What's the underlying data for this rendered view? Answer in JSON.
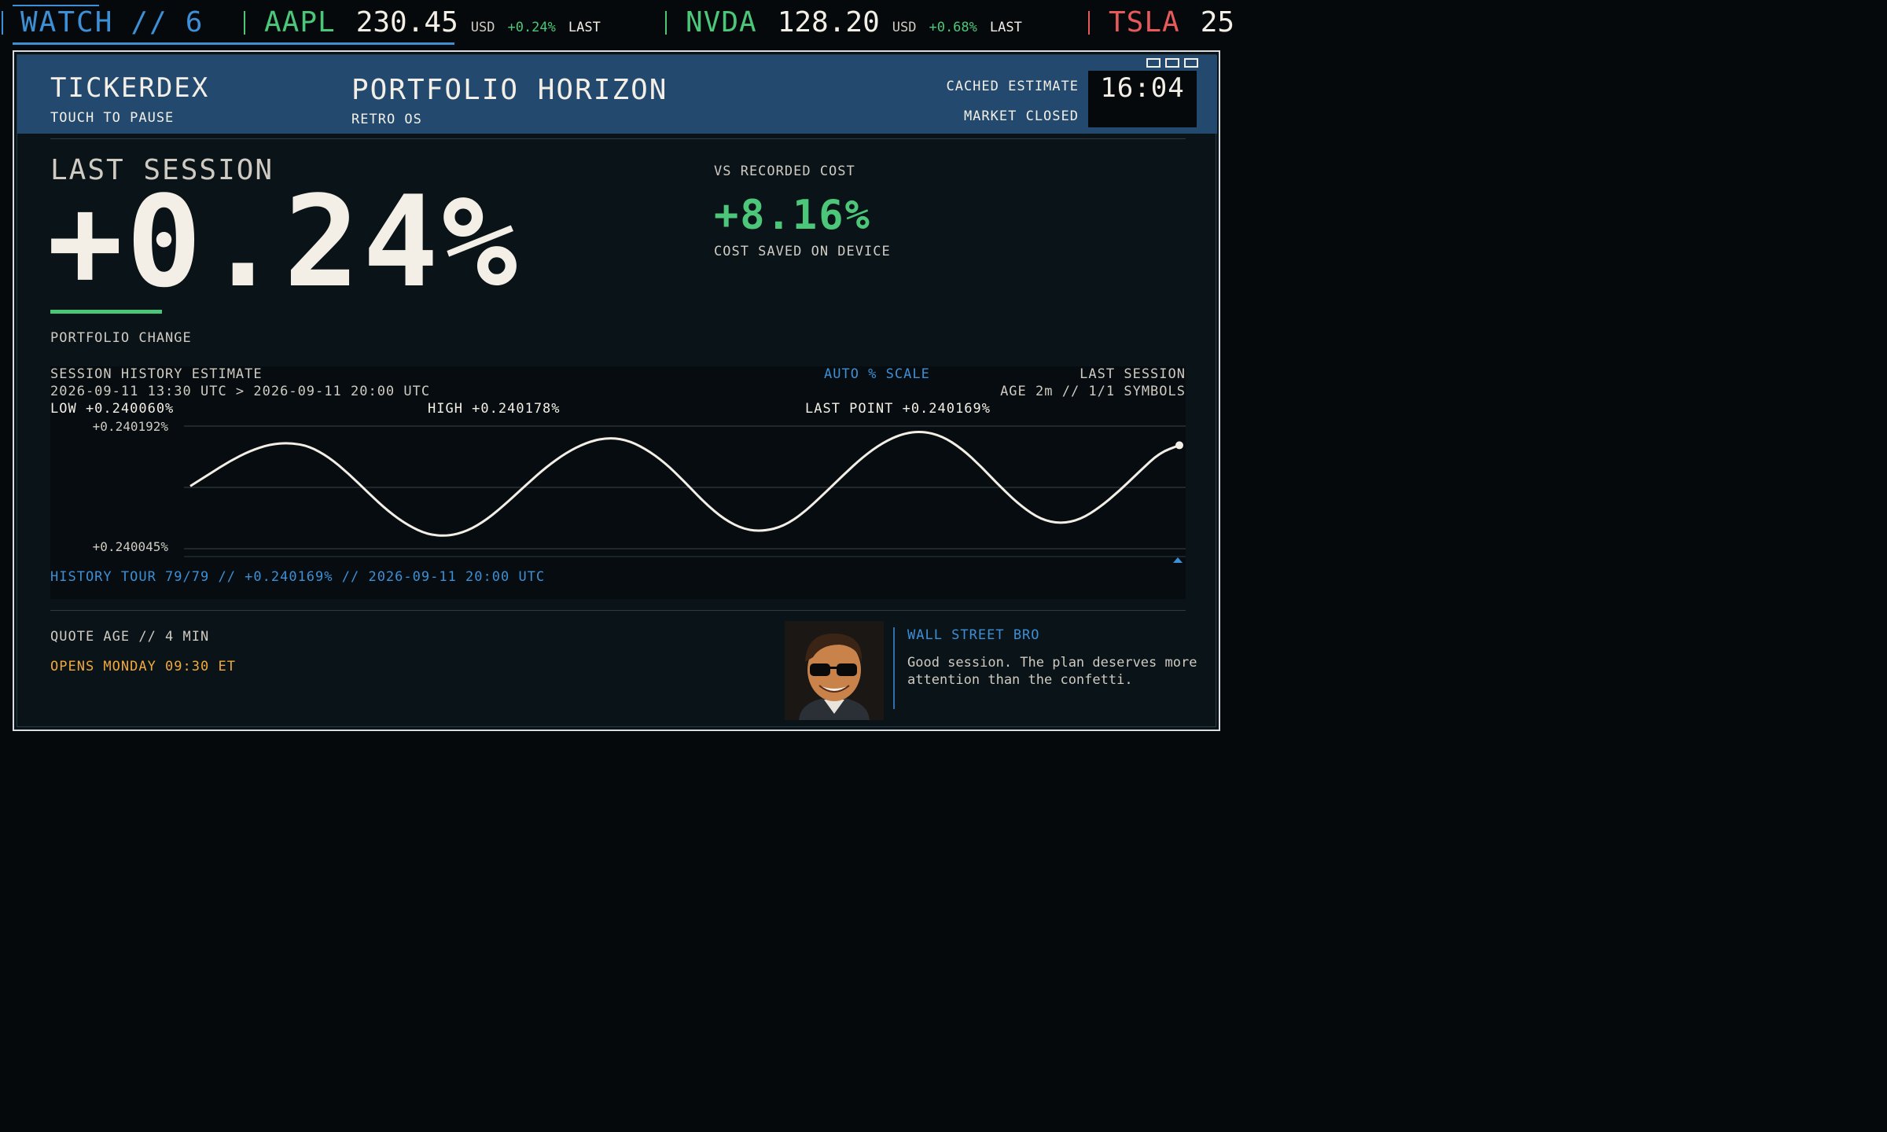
{
  "ticker": {
    "watch_label": "WATCH",
    "watch_sep": "//",
    "watch_count": "6",
    "items": [
      {
        "symbol": "AAPL",
        "price": "230.45",
        "currency": "USD",
        "change": "+0.24%",
        "status": "LAST",
        "color": "#4cc77a"
      },
      {
        "symbol": "NVDA",
        "price": "128.20",
        "currency": "USD",
        "change": "+0.68%",
        "status": "LAST",
        "color": "#4cc77a"
      },
      {
        "symbol": "TSLA",
        "price": "25",
        "color": "#e85a5a"
      }
    ]
  },
  "header": {
    "brand": "TICKERDEX",
    "brand_sub": "TOUCH TO PAUSE",
    "title": "PORTFOLIO HORIZON",
    "subtitle": "RETRO OS",
    "cache_status": "CACHED ESTIMATE",
    "market_status": "MARKET CLOSED",
    "clock": "16:04"
  },
  "summary": {
    "section_label": "LAST SESSION",
    "big_value": "+0.24%",
    "change_label": "PORTFOLIO CHANGE",
    "vs_label": "VS RECORDED COST",
    "vs_value": "+8.16%",
    "vs_sub": "COST SAVED ON DEVICE"
  },
  "chart": {
    "title": "SESSION HISTORY ESTIMATE",
    "range": "2026-09-11 13:30 UTC > 2026-09-11 20:00 UTC",
    "scale_mode": "AUTO % SCALE",
    "session": "LAST SESSION",
    "age": "AGE 2m // 1/1 SYMBOLS",
    "low": "LOW +0.240060%",
    "high": "HIGH +0.240178%",
    "last_point": "LAST POINT +0.240169%",
    "y_top_label": "+0.240192%",
    "y_bottom_label": "+0.240045%",
    "tour": "HISTORY TOUR 79/79 // +0.240169% // 2026-09-11 20:00 UTC"
  },
  "chart_data": {
    "type": "line",
    "ylim": [
      0.240045,
      0.240192
    ],
    "grid": true,
    "series": [
      {
        "values": [
          0.24012,
          0.240135,
          0.24015,
          0.240162,
          0.24017,
          0.240172,
          0.240168,
          0.240155,
          0.240135,
          0.240112,
          0.24009,
          0.240073,
          0.240062,
          0.24006,
          0.240066,
          0.24008,
          0.2401,
          0.240122,
          0.240143,
          0.24016,
          0.240172,
          0.240178,
          0.240176,
          0.240165,
          0.240148,
          0.240125,
          0.2401,
          0.24008,
          0.240068,
          0.240066,
          0.240072,
          0.240088,
          0.24011,
          0.240133,
          0.240155,
          0.240172,
          0.240183,
          0.240186,
          0.24018,
          0.240165,
          0.240143,
          0.240118,
          0.240096,
          0.24008,
          0.240075,
          0.24008,
          0.240095,
          0.240115,
          0.240138,
          0.24016,
          0.240169
        ]
      }
    ]
  },
  "footer": {
    "quote_age": "QUOTE AGE // 4 MIN",
    "opens": "OPENS MONDAY 09:30 ET",
    "bro_name": "WALL STREET BRO",
    "bro_message": "Good session. The plan deserves more attention than the confetti."
  },
  "colors": {
    "accent": "#3d8fd6",
    "positive": "#4cc77a",
    "negative": "#e85a5a",
    "warning": "#f2a93b",
    "header_bg": "#234a6e"
  }
}
